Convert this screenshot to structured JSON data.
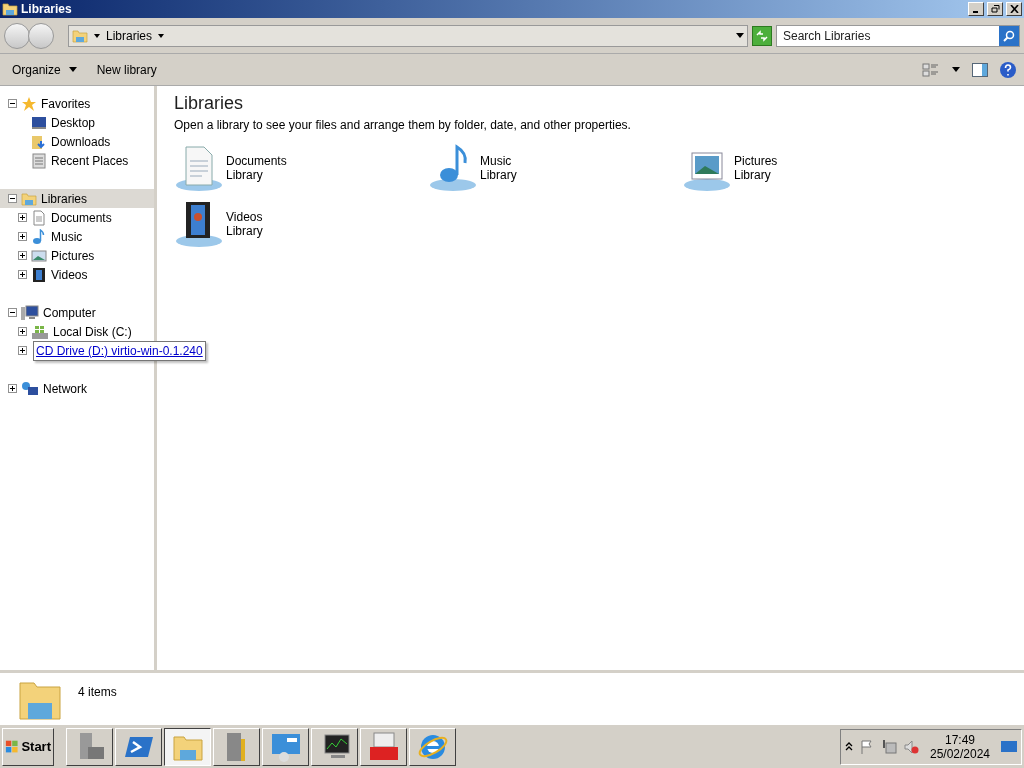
{
  "window": {
    "title": "Libraries"
  },
  "address_bar": {
    "breadcrumb": "Libraries"
  },
  "search": {
    "placeholder": "Search Libraries"
  },
  "command_bar": {
    "buttons": [
      {
        "label": "Organize",
        "dropdown": true
      },
      {
        "label": "New library",
        "dropdown": false
      }
    ]
  },
  "navigation_tree": [
    {
      "label": "Favorites",
      "expanded": true,
      "selected": false,
      "children": [
        {
          "label": "Desktop",
          "selected": false
        },
        {
          "label": "Downloads",
          "selected": false
        },
        {
          "label": "Recent Places",
          "selected": false
        }
      ]
    },
    {
      "label": "Libraries",
      "expanded": true,
      "selected": true,
      "children": [
        {
          "label": "Documents",
          "expanded": false,
          "selected": false
        },
        {
          "label": "Music",
          "expanded": false,
          "selected": false
        },
        {
          "label": "Pictures",
          "expanded": false,
          "selected": false
        },
        {
          "label": "Videos",
          "expanded": false,
          "selected": false
        }
      ]
    },
    {
      "label": "Computer",
      "expanded": true,
      "selected": false,
      "children": [
        {
          "label": "Local Disk (C:)",
          "expanded": false,
          "selected": false
        },
        {
          "label": "CD Drive (D:) virtio-win-0.1.240",
          "expanded": false,
          "selected": false,
          "hovered": true
        }
      ]
    },
    {
      "label": "Network",
      "expanded": false,
      "selected": false
    }
  ],
  "content": {
    "heading": "Libraries",
    "description": "Open a library to see your files and arrange them by folder, date, and other properties.",
    "libraries": [
      {
        "name": "Documents",
        "type": "Library"
      },
      {
        "name": "Music",
        "type": "Library"
      },
      {
        "name": "Pictures",
        "type": "Library"
      },
      {
        "name": "Videos",
        "type": "Library"
      }
    ]
  },
  "status_bar": {
    "item_count": "4 items"
  },
  "taskbar": {
    "start": "Start",
    "buttons": [
      {
        "selected": false
      },
      {
        "selected": false
      },
      {
        "selected": true
      },
      {
        "selected": false
      },
      {
        "selected": false
      },
      {
        "selected": false
      },
      {
        "selected": false
      },
      {
        "selected": false
      }
    ],
    "clock": {
      "time": "17:49",
      "date": "25/02/2024"
    }
  }
}
